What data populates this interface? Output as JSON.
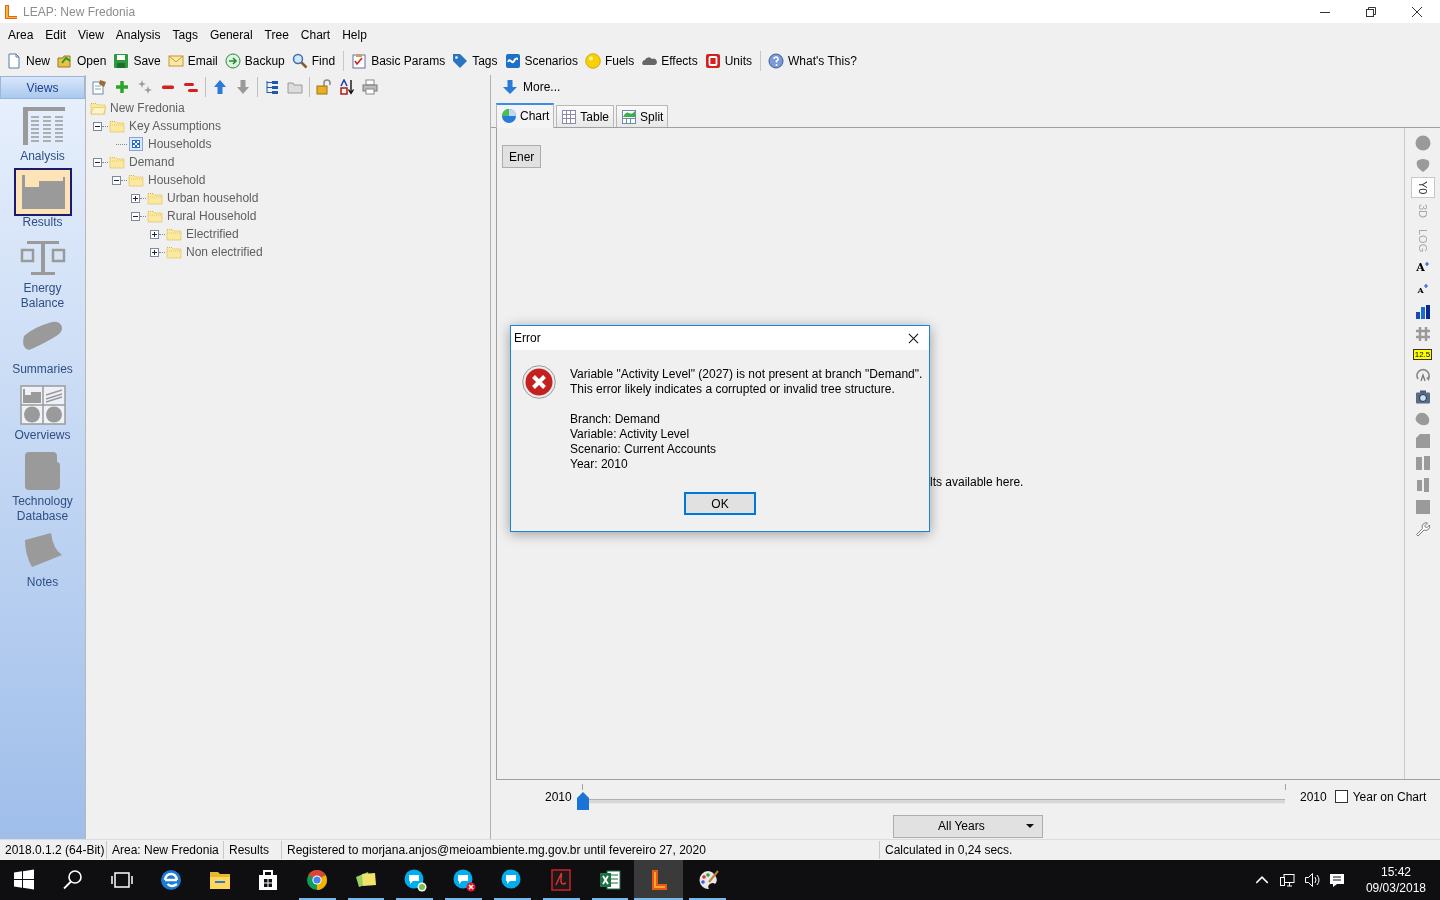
{
  "window": {
    "title": "LEAP: New Fredonia"
  },
  "menu": [
    "Area",
    "Edit",
    "View",
    "Analysis",
    "Tags",
    "General",
    "Tree",
    "Chart",
    "Help"
  ],
  "toolbar": [
    [
      "New",
      "Open",
      "Save",
      "Email",
      "Backup",
      "Find"
    ],
    [
      "Basic Params",
      "Tags",
      "Scenarios",
      "Fuels",
      "Effects",
      "Units"
    ],
    [
      "What's This?"
    ]
  ],
  "views": {
    "header": "Views",
    "items": [
      {
        "label": "Analysis",
        "selected": false
      },
      {
        "label": "Results",
        "selected": true
      },
      {
        "label": "Energy Balance",
        "selected": false
      },
      {
        "label": "Summaries",
        "selected": false
      },
      {
        "label": "Overviews",
        "selected": false
      },
      {
        "label": "Technology Database",
        "selected": false
      },
      {
        "label": "Notes",
        "selected": false
      }
    ]
  },
  "tree": [
    {
      "label": "New Fredonia",
      "kind": "root",
      "expanded": true,
      "children": [
        {
          "label": "Key Assumptions",
          "kind": "branch",
          "expanded": true,
          "children": [
            {
              "label": "Households",
              "kind": "key",
              "expanded": false
            }
          ]
        },
        {
          "label": "Demand",
          "kind": "branch",
          "expanded": true,
          "children": [
            {
              "label": "Household",
              "kind": "branch",
              "expanded": true,
              "children": [
                {
                  "label": "Urban household",
                  "kind": "branch",
                  "expanded": false
                },
                {
                  "label": "Rural Household",
                  "kind": "branch",
                  "expanded": true,
                  "children": [
                    {
                      "label": "Electrified",
                      "kind": "branch",
                      "expanded": false
                    },
                    {
                      "label": "Non electrified",
                      "kind": "branch",
                      "expanded": false
                    }
                  ]
                }
              ]
            }
          ]
        }
      ]
    }
  ],
  "more_button": "More...",
  "tabs": [
    {
      "label": "Chart",
      "selected": true
    },
    {
      "label": "Table",
      "selected": false
    },
    {
      "label": "Split",
      "selected": false
    }
  ],
  "chart_panel": {
    "category_button": "Ener",
    "hidden_message": "lts available here."
  },
  "side_toolbar": {
    "toggles": [
      {
        "label": "Y0",
        "pressed": true,
        "disabled": false
      },
      {
        "label": "3D",
        "pressed": false,
        "disabled": true
      },
      {
        "label": "LOG",
        "pressed": false,
        "disabled": true
      }
    ],
    "font_buttons": [
      "A",
      "A"
    ],
    "value_badge": "12.5"
  },
  "year_slider": {
    "start": "2010",
    "end": "2010",
    "level": 0
  },
  "year_on_chart": {
    "label": "Year on Chart",
    "checked": false
  },
  "years_dropdown": {
    "value": "All Years"
  },
  "status_bar": [
    "2018.0.1.2 (64-Bit)",
    "Area: New Fredonia",
    "Results",
    "Registered to morjana.anjos@meioambiente.mg.gov.br until fevereiro 27, 2020",
    "Calculated in 0,24 secs."
  ],
  "dialog": {
    "title": "Error",
    "message": [
      "Variable \"Activity Level\" (2027) is not present at branch \"Demand\".",
      "This error likely indicates a corrupted or invalid tree structure."
    ],
    "details": [
      "Branch: Demand",
      "Variable: Activity Level",
      "Scenario: Current Accounts",
      "Year: 2010"
    ],
    "button": "OK"
  },
  "taskbar": {
    "apps": [
      {
        "running": false,
        "active": false
      },
      {
        "running": false,
        "active": false
      },
      {
        "running": false,
        "active": false
      },
      {
        "running": true,
        "active": false
      },
      {
        "running": true,
        "active": false
      },
      {
        "running": true,
        "active": false
      },
      {
        "running": true,
        "active": false
      },
      {
        "running": true,
        "active": false
      },
      {
        "running": true,
        "active": false
      },
      {
        "running": true,
        "active": false
      },
      {
        "running": true,
        "active": true
      },
      {
        "running": true,
        "active": false
      }
    ],
    "time": "15:42",
    "date": "09/03/2018"
  }
}
